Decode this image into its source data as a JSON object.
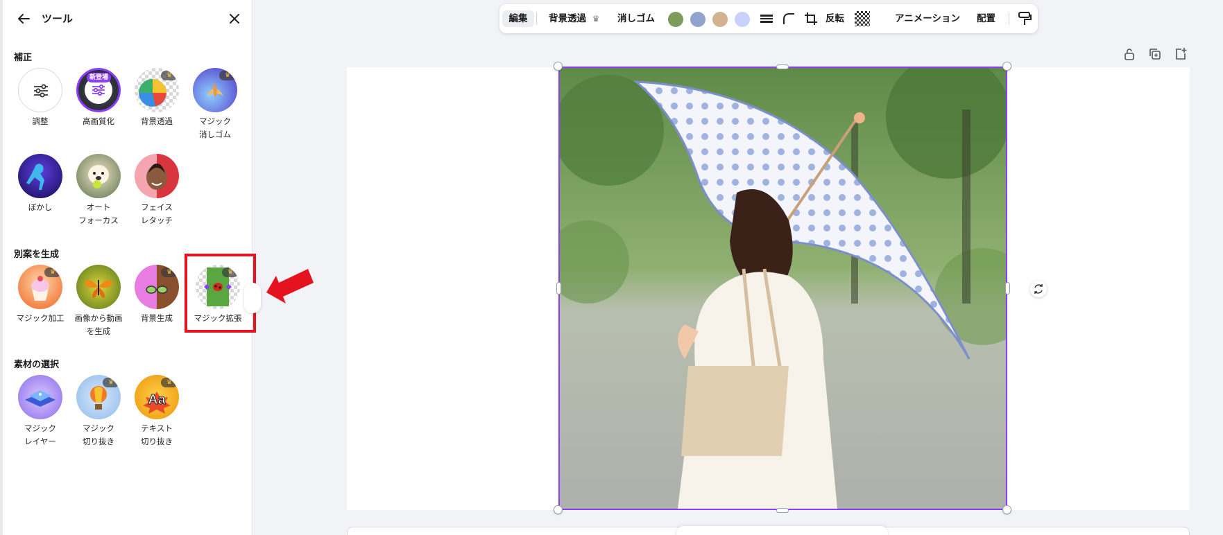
{
  "panel": {
    "title": "ツール",
    "sections": {
      "adjust": "補正",
      "generate": "別案を生成",
      "select": "素材の選択"
    },
    "tools": {
      "adjust": "調整",
      "upscale": "高画質化",
      "upscale_badge": "新登場",
      "bg_remove": "背景透過",
      "magic_eraser": "マジック\n消しゴム",
      "blur": "ぼかし",
      "autofocus": "オート\nフォーカス",
      "face_retouch": "フェイス\nレタッチ",
      "magic_edit": "マジック加工",
      "image_to_video": "画像から動画\nを生成",
      "bg_generate": "背景生成",
      "magic_expand": "マジック拡張",
      "magic_layer": "マジック\nレイヤー",
      "magic_cutout": "マジック\n切り抜き",
      "text_cutout": "テキスト\n切り抜き"
    }
  },
  "toolbar": {
    "edit": "編集",
    "bg_remove": "背景透過",
    "eraser": "消しゴム",
    "flip": "反転",
    "animate": "アニメーション",
    "position": "配置",
    "palette": [
      "#7d9b5a",
      "#8fa3cc",
      "#d1b48f",
      "#c9d2ff"
    ]
  },
  "icons": {
    "back": "arrow-left-icon",
    "close": "close-icon",
    "crown": "crown-icon",
    "lock": "lock-icon",
    "duplicate": "duplicate-page-icon",
    "add_page": "add-page-icon",
    "rotate": "rotate-icon",
    "pointer": "red-arrow-pointer"
  },
  "colors": {
    "accent": "#8b3dff",
    "highlight": "#e5121f"
  }
}
